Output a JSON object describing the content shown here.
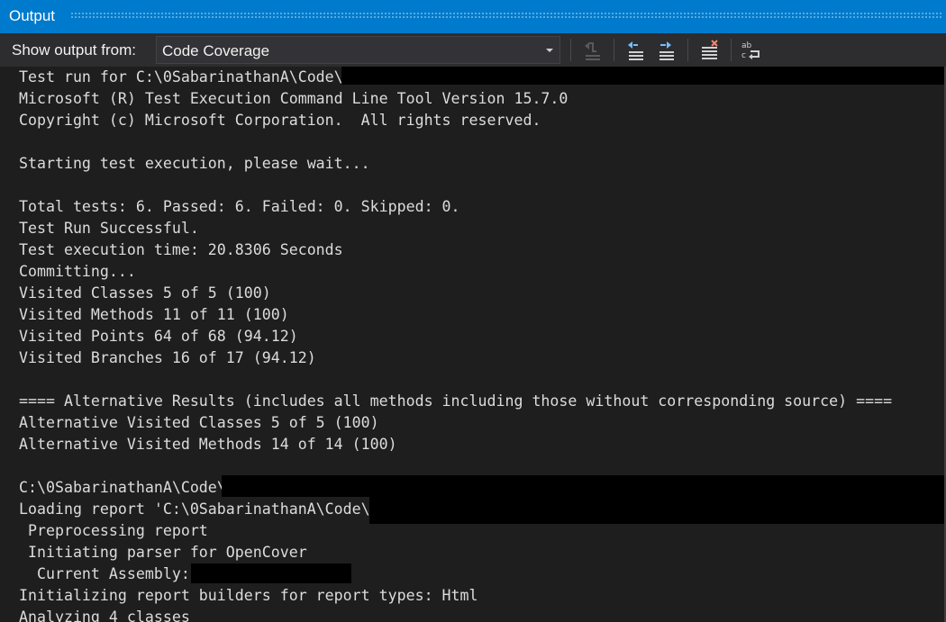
{
  "window": {
    "title": "Output"
  },
  "toolbar": {
    "show_output_label": "Show output from:",
    "source_selected": "Code Coverage",
    "buttons": [
      {
        "name": "go-to-location",
        "icon": "go-to-location-icon",
        "enabled": false
      },
      {
        "name": "previous-message",
        "icon": "previous-message-icon",
        "enabled": true
      },
      {
        "name": "next-message",
        "icon": "next-message-icon",
        "enabled": true
      },
      {
        "name": "clear-all",
        "icon": "clear-all-icon",
        "enabled": true
      },
      {
        "name": "toggle-word-wrap",
        "icon": "word-wrap-icon",
        "enabled": true
      }
    ]
  },
  "colors": {
    "title_bar": "#007acc",
    "toolbar_bg": "#2d2d30",
    "output_bg": "#1e1e1e",
    "text": "#dcdcdc",
    "redaction": "#000000",
    "icon_blue": "#75beff",
    "icon_red": "#f48771"
  },
  "output": {
    "lines": [
      "Test run for C:\\0SabarinathanA\\Code\\",
      "Microsoft (R) Test Execution Command Line Tool Version 15.7.0",
      "Copyright (c) Microsoft Corporation.  All rights reserved.",
      "",
      "Starting test execution, please wait...",
      "",
      "Total tests: 6. Passed: 6. Failed: 0. Skipped: 0.",
      "Test Run Successful.",
      "Test execution time: 20.8306 Seconds",
      "Committing...",
      "Visited Classes 5 of 5 (100)",
      "Visited Methods 11 of 11 (100)",
      "Visited Points 64 of 68 (94.12)",
      "Visited Branches 16 of 17 (94.12)",
      "",
      "==== Alternative Results (includes all methods including those without corresponding source) ====",
      "Alternative Visited Classes 5 of 5 (100)",
      "Alternative Visited Methods 14 of 14 (100)",
      "",
      "C:\\0SabarinathanA\\Code\\",
      "Loading report 'C:\\0SabarinathanA\\Code\\",
      " Preprocessing report",
      " Initiating parser for OpenCover",
      "  Current Assembly:",
      "Initializing report builders for report types: Html",
      "Analyzing 4 classes"
    ]
  }
}
